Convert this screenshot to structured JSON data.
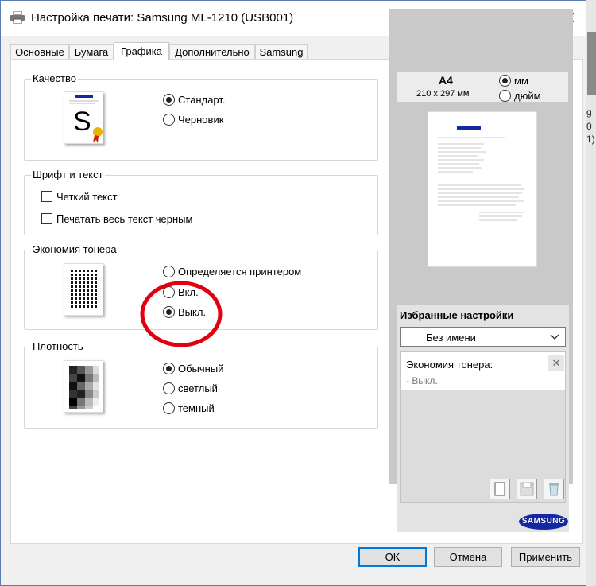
{
  "window": {
    "title": "Настройка печати: Samsung ML-1210 (USB001)",
    "close_glyph": "✕"
  },
  "background_fragments": [
    "g",
    "0",
    "1)"
  ],
  "tabs": [
    {
      "label": "Основные",
      "active": false
    },
    {
      "label": "Бумага",
      "active": false
    },
    {
      "label": "Графика",
      "active": true
    },
    {
      "label": "Дополнительно",
      "active": false
    },
    {
      "label": "Samsung",
      "active": false
    }
  ],
  "quality": {
    "legend": "Качество",
    "options": [
      {
        "label": "Стандарт.",
        "selected": true
      },
      {
        "label": "Черновик",
        "selected": false
      }
    ]
  },
  "font_text": {
    "legend": "Шрифт и текст",
    "options": [
      {
        "label": "Четкий текст",
        "checked": false
      },
      {
        "label": "Печатать весь текст черным",
        "checked": false
      }
    ]
  },
  "toner": {
    "legend": "Экономия тонера",
    "options": [
      {
        "label": "Определяется принтером",
        "selected": false
      },
      {
        "label": "Вкл.",
        "selected": false
      },
      {
        "label": "Выкл.",
        "selected": true
      }
    ]
  },
  "density": {
    "legend": "Плотность",
    "options": [
      {
        "label": "Обычный",
        "selected": true
      },
      {
        "label": "светлый",
        "selected": false
      },
      {
        "label": "темный",
        "selected": false
      }
    ]
  },
  "paper": {
    "size": "A4",
    "dims": "210 x 297 мм",
    "units": [
      {
        "label": "мм",
        "selected": true
      },
      {
        "label": "дюйм",
        "selected": false
      }
    ]
  },
  "favorites": {
    "heading": "Избранные настройки",
    "selected": "Без имени",
    "item_label": "Экономия тонера:",
    "item_value": "- Выкл.",
    "remove_glyph": "✕"
  },
  "brand": "SAMSUNG",
  "thumb_letter": "S",
  "buttons": {
    "ok": "OK",
    "cancel": "Отмена",
    "apply": "Применить"
  },
  "colors": {
    "accent": "#0078d7",
    "annotation": "#e00010",
    "brand": "#1428a0"
  }
}
